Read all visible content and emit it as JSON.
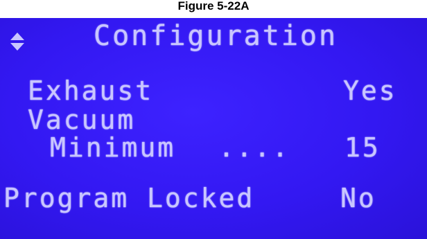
{
  "caption": "Figure 5-22A",
  "screen": {
    "title": "Configuration",
    "scroll_icon": "up-down-arrows-icon",
    "rows": {
      "exhaust": {
        "label": "Exhaust",
        "value": "Yes"
      },
      "vacuum": {
        "label": "Vacuum"
      },
      "vacuum_minimum": {
        "label": "Minimum",
        "leader": "....",
        "value": "15"
      },
      "program_locked": {
        "label": "Program Locked",
        "value": "No"
      }
    }
  },
  "colors": {
    "lcd_background": "#3318f2",
    "lcd_text": "#c9c6ff"
  }
}
